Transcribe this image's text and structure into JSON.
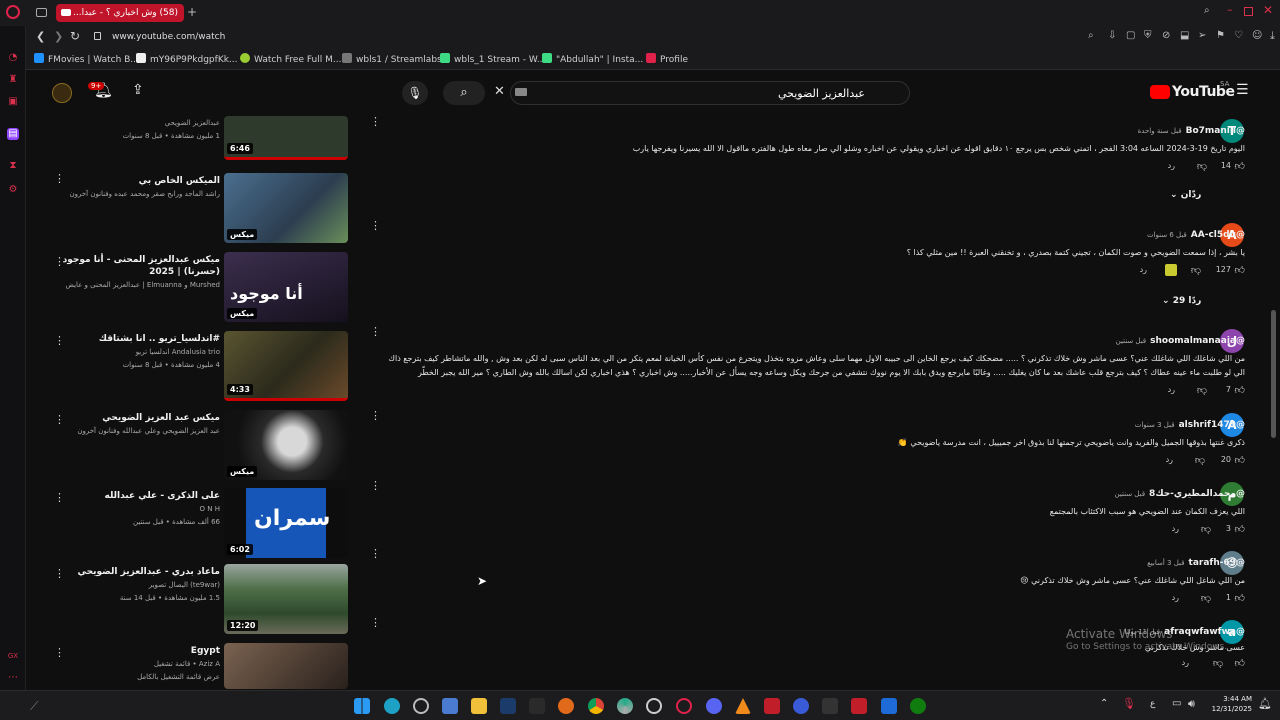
{
  "browser": {
    "tab_title": "(58) وش اخباري ؟ - عبدا...",
    "address": "www.youtube.com/watch",
    "bookmarks": [
      {
        "label": "FMovies | Watch B...",
        "color": "#1e90ff"
      },
      {
        "label": "mY96P9Pkdgpf​Kk...",
        "color": "#eeeeee"
      },
      {
        "label": "Watch Free Full M...",
        "color": "#9acd32"
      },
      {
        "label": "wbls1 / Streamlabs",
        "color": "#777"
      },
      {
        "label": "wbls_1 Stream - W...",
        "color": "#3ddc84"
      },
      {
        "label": "\"Abdullah\" | Insta...",
        "color": "#3ddc84"
      },
      {
        "label": "Profile",
        "color": "#e0224b"
      }
    ]
  },
  "header": {
    "search_value": "عبدالعزيز الضويحي",
    "logo_text": "YouTube",
    "region": "SA",
    "notification_badge": "9+"
  },
  "videos": [
    {
      "title": "",
      "channel": "عبدالعزيز الضويحي",
      "meta": "1 مليون مشاهدة • قبل 8 سنوات",
      "duration": "6:46",
      "thumb": "#2e3b2c"
    },
    {
      "title": "الميكس الخاص بي",
      "channel": "راشد الماجد ورابح صقر ومحمد عبده وفنانون آخرون",
      "meta": "",
      "duration": "ميكس",
      "thumb": "#3d5770"
    },
    {
      "title": "ميكس عبدالعزيز المحنى - أنا موجود (حسرنا) | 2025",
      "channel": "Murshed و Elmuanna | عبدالعزيز المحنى و عايض",
      "meta": "",
      "duration": "ميكس",
      "thumb": "#2a2236"
    },
    {
      "title": "#اندلسيا_تريو .. انا بشتاقك",
      "channel": "Andalusia trio اندلسيا تريو",
      "meta": "4 مليون مشاهدة • قبل 8 سنوات",
      "duration": "4:33",
      "thumb": "#3e3a26"
    },
    {
      "title": "ميكس عبد العزيز الضويحي",
      "channel": "عبد العزيز الضويحي وعلي عبدالله وفنانون آخرون",
      "meta": "",
      "duration": "ميكس",
      "thumb": "#1d1d1d"
    },
    {
      "title": "على الذكرى - علي عبدالله",
      "channel": "O N H",
      "meta": "66 ألف مشاهدة • قبل سنتين",
      "duration": "6:02",
      "thumb": "#102f6b"
    },
    {
      "title": "ماعاد بدري - عبدالعزيز الضويحي",
      "channel": "(te9war) اليصال تصوير",
      "meta": "1.5 مليون مشاهدة • قبل 14 سنة",
      "duration": "12:20",
      "thumb": "#3a5b3a"
    },
    {
      "title": "Egypt",
      "channel": "Aziz A • قائمة تشغيل",
      "meta": "عرض قائمة التشغيل بالكامل",
      "duration": "",
      "thumb": "#5a4a3e"
    }
  ],
  "comments": [
    {
      "author": "@Bo7maniii",
      "time": "قبل سنة واحدة",
      "text": "اليوم تاريخ 19-3-2024 الساعه 3:04 الفجر ، اتمني شخص بس يرجع ١٠ دقايق اقوله عن اخباري ويقولي عن اخباره وشلو الي صار معاه طول هالفتره مااقول الا الله يسيرنا ويفرجها يارب",
      "likes": "14",
      "avatar_letter": "T",
      "avatar_color": "#00897b",
      "replies": "ردّان"
    },
    {
      "author": "@AA-cl5du",
      "time": "قبل 6 سنوات",
      "text": "يا بشر ، إذا سمعت الضويحي و صوت الكمان ، تجيني كتمة بصدري ، و تخنقني العبرة !! مين مثلي كذا ؟",
      "likes": "127",
      "avatar_letter": "A",
      "avatar_color": "#e64a19",
      "replies": "29 ردًا"
    },
    {
      "author": "@shoomalmanaaia",
      "time": "قبل سنتين",
      "text": "من اللي شاغلك اللي شاغلك عني؟ عسى ماشر وش خلاك تذكرني ؟ ..... مضحكك كيف يرجع الخاين الى حبيبه الاول مهما سلى وعاش مزوه بتخذل ويتجرع من نفس كأس الخيانة لمعم يتكر من الي بعد الناس سبى له لكن بعد وش , والله ماتشاطر كيف بترجع ذاك الي لو طلبت ماء عينه عطاك ؟ كيف بترجع قلب عاشك بعد ما كان يغليك ..... وغالبًا مايرجع ويدق بابك الا يوم نووك نتشفي من جرحك ويكل وساعه وجه يسأل عن الأخبار..... وش اخباري ؟ هذي اخباري لكن اسالك بالله وش الطاري ؟ مير الله يجبر الخطّر",
      "likes": "7",
      "avatar_letter": "ل",
      "avatar_color": "#8e44ad",
      "replies": ""
    },
    {
      "author": "@alshrif1479",
      "time": "قبل 3 سنوات",
      "text": "ذكرى غنتها بذوقها الجميل والفريد وانت ياضويحي ترجمتها لنا بذوق اخر جميييل ، انت مدرسة ياضويحي 👏",
      "likes": "20",
      "avatar_letter": "A",
      "avatar_color": "#1e88e5",
      "replies": ""
    },
    {
      "author": "@محمدالمطيري-حك8",
      "time": "قبل سنتين",
      "text": "اللي يعزف الكمان عند الضويحي هو سبب الاكتئاب بالمجتمع",
      "likes": "3",
      "avatar_letter": "م",
      "avatar_color": "#2e7d32",
      "replies": ""
    },
    {
      "author": "@tarafh-69",
      "time": "قبل 3 أسابيع",
      "text": "من اللي شاغل اللي شاغلك عني؟ عسى ماشر وش خلاك تذكرني 😢",
      "likes": "1",
      "avatar_letter": "",
      "avatar_color": "#607d8b",
      "replies": ""
    },
    {
      "author": "@afraqwfawfwa",
      "time": "قبل 11 يومًا",
      "text": "عسى ماشر وش خلاك تذكرني",
      "likes": "",
      "avatar_letter": "a",
      "avatar_color": "#0097a7",
      "replies": ""
    }
  ],
  "reply_label": "رد",
  "watermark": {
    "line1": "Activate Windows",
    "line2": "Go to Settings to activate Windows."
  },
  "clock": {
    "time": "3:44 AM",
    "date": "12/31/2025"
  },
  "taskbar_lang": "ع"
}
